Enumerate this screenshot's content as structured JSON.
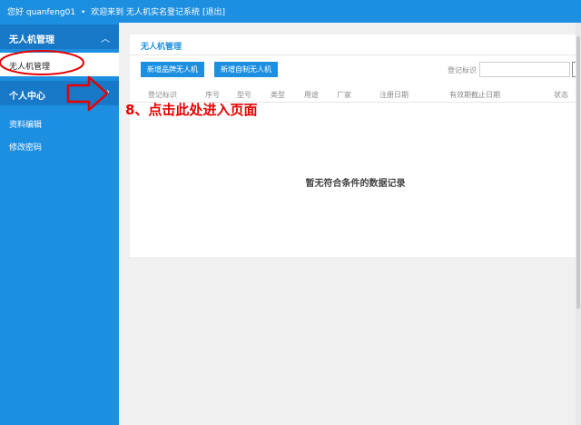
{
  "topbar": {
    "username_prefix": "您好 quanfeng01",
    "separator": "•",
    "welcome": "欢迎来到 无人机实名登记系统",
    "logout": "[退出]"
  },
  "sidebar": {
    "groups": [
      {
        "label": "无人机管理",
        "chevron": "︿"
      },
      {
        "label": "个人中心",
        "chevron": "›"
      }
    ],
    "items": [
      {
        "label": "无人机管理"
      },
      {
        "label": "资料编辑"
      },
      {
        "label": "修改密码"
      }
    ]
  },
  "main": {
    "title": "无人机管理",
    "buttons": {
      "add_brand": "新增品牌无人机",
      "add_custom": "新增自制无人机"
    },
    "search": {
      "label": "登记标识",
      "placeholder": ""
    },
    "columns": [
      "登记标识",
      "序号",
      "型号",
      "类型",
      "用途",
      "厂家",
      "注册日期",
      "有效期截止日期",
      "状态"
    ],
    "empty_text": "暂无符合条件的数据记录"
  },
  "annotation": {
    "text": "8、点击此处进入页面",
    "color": "#e60000"
  },
  "colors": {
    "primary": "#1d8fe1",
    "sidebar_group": "#1878c8",
    "background": "#f0f0f0"
  }
}
